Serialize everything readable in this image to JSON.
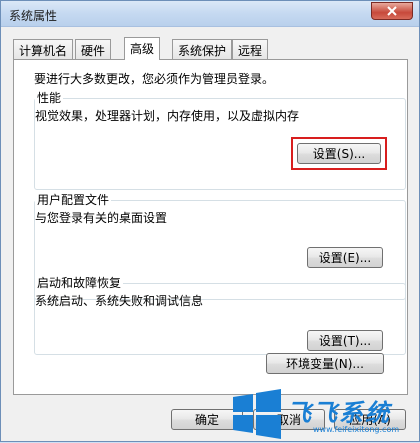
{
  "window": {
    "title": "系统属性",
    "close_icon": "close-icon"
  },
  "tabs": [
    {
      "label": "计算机名",
      "active": false
    },
    {
      "label": "硬件",
      "active": false
    },
    {
      "label": "高级",
      "active": true
    },
    {
      "label": "系统保护",
      "active": false
    },
    {
      "label": "远程",
      "active": false
    }
  ],
  "advanced": {
    "intro": "要进行大多数更改，您必须作为管理员登录。",
    "performance": {
      "title": "性能",
      "description": "视觉效果，处理器计划，内存使用，以及虚拟内存",
      "button": "设置(S)..."
    },
    "user_profiles": {
      "title": "用户配置文件",
      "description": "与您登录有关的桌面设置",
      "button": "设置(E)..."
    },
    "startup_recovery": {
      "title": "启动和故障恢复",
      "description": "系统启动、系统失败和调试信息",
      "button": "设置(T)..."
    },
    "env_button": "环境变量(N)..."
  },
  "footer": {
    "ok": "确定",
    "cancel": "取消",
    "apply": "应用(A)"
  },
  "watermark": {
    "name": "飞飞系统",
    "url": "www.feifeixitong.com",
    "logo_icon": "windows-logo-icon",
    "brand_color": "#1a7fd4"
  },
  "colors": {
    "highlight": "#d81e1e"
  }
}
